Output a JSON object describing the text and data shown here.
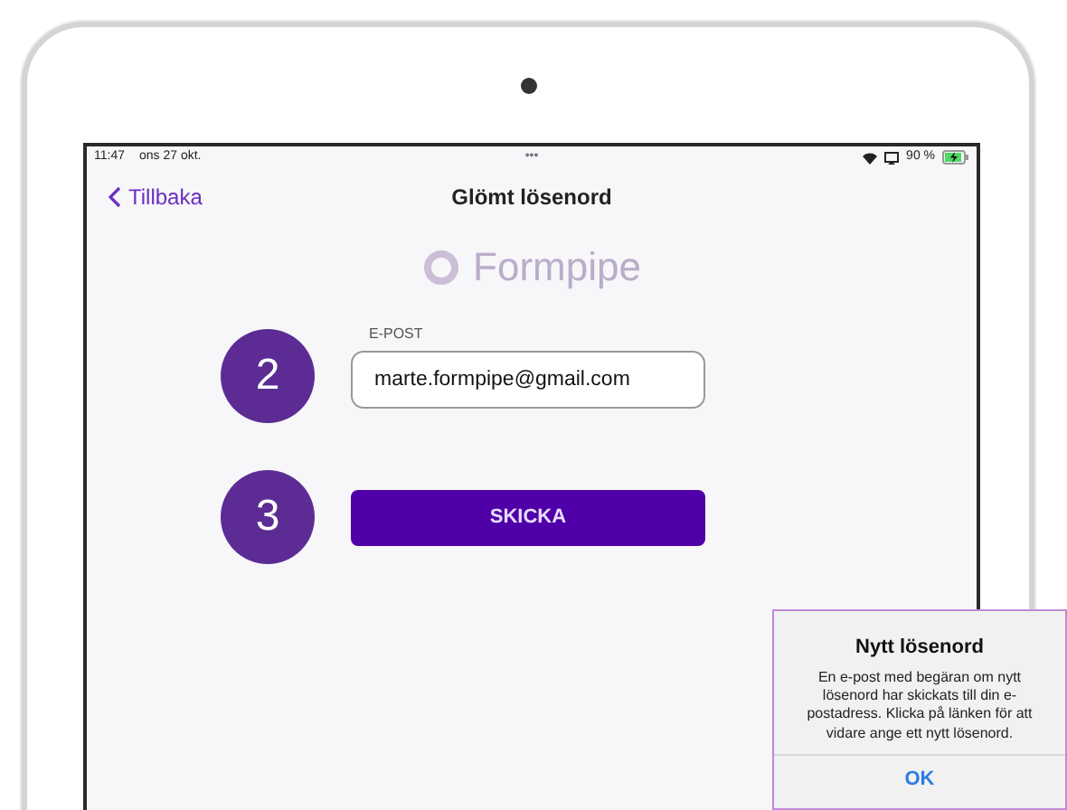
{
  "status_bar": {
    "time": "11:47",
    "date": "ons 27 okt.",
    "dots": "•••",
    "battery_percent": "90 %",
    "charging": true
  },
  "nav": {
    "back": "Tillbaka",
    "title": "Glömt lösenord"
  },
  "logo_text": "Formpipe",
  "steps": [
    {
      "number": "2",
      "kind": "field",
      "label": "E-POST",
      "value": "marte.formpipe@gmail.com"
    },
    {
      "number": "3",
      "kind": "button",
      "label": "SKICKA"
    }
  ],
  "alert": {
    "title": "Nytt lösenord",
    "message": "En e-post med begäran om nytt lösenord har skickats till din e-postadress. Klicka på länken för att vidare ange ett nytt lösenord.",
    "button": "OK"
  }
}
